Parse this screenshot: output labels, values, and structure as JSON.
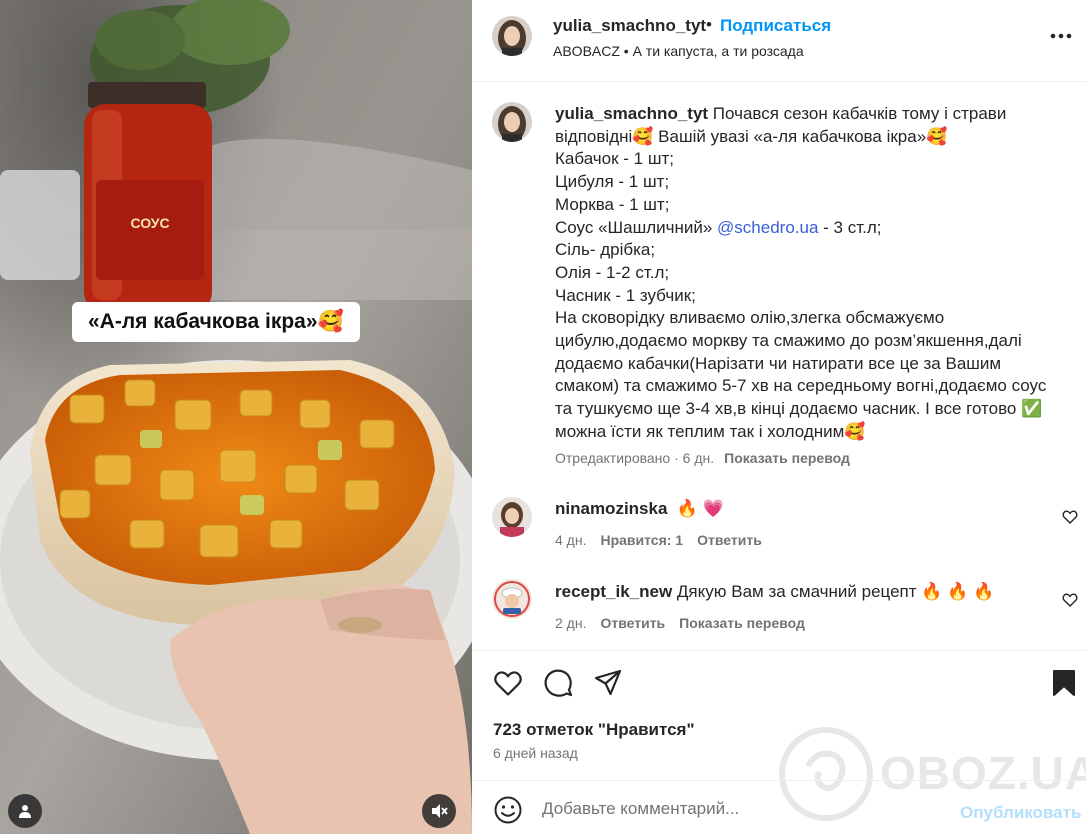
{
  "media": {
    "overlay_caption": "«А-ля кабачкова ікра»🥰"
  },
  "header": {
    "username": "yulia_smachno_tyt",
    "dot": "•",
    "follow_label": "Подписаться",
    "audio": "ABOBACZ • А ти капуста, а ти розсада"
  },
  "caption": {
    "username": "yulia_smachno_tyt",
    "lines": [
      "Почався сезон кабачків тому і страви",
      "відповідні🥰  Вашій увазі «а-ля кабачкова ікра»🥰",
      "Кабачок - 1 шт;",
      "Цибуля - 1 шт;",
      "Морква - 1 шт;",
      "Соус «Шашличний» ",
      "Сіль- дрібка;",
      "Олія - 1-2 ст.л;",
      "Часник - 1 зубчик;",
      "На сковорідку вливаємо олію,злегка обсмажуємо",
      "цибулю,додаємо моркву та смажимо до розм’якшення,далі",
      "додаємо кабачки(Нарізати чи натирати все це за Вашим",
      "смаком) та смажимо 5-7 хв на середньому вогні,додаємо соус",
      "та тушкуємо ще 3-4 хв,в кінці додаємо часник. І все готово ✅",
      "можна їсти як теплим так і холодним🥰"
    ],
    "mention": "@schedro.ua",
    "mention_suffix": " - 3 ст.л;",
    "edited": "Отредактировано",
    "time": " · 6 дн.",
    "translate": "Показать перевод"
  },
  "comments": [
    {
      "username": "ninamozinska",
      "text": "🔥 💗",
      "time": "4 дн.",
      "likes": "Нравится: 1",
      "reply": "Ответить"
    },
    {
      "username": "recept_ik_new",
      "text": "Дякую Вам за смачний рецепт  🔥 🔥 🔥",
      "time": "2 дн.",
      "reply": "Ответить",
      "translate": "Показать перевод"
    }
  ],
  "actions": {
    "likes": "723 отметок \"Нравится\"",
    "posted": "6 дней назад"
  },
  "add_comment": {
    "placeholder": "Добавьте комментарий...",
    "publish": "Опубликовать"
  },
  "watermark": {
    "text": "OBOZ.UA"
  },
  "icons": {
    "like": "heart-icon",
    "comment": "comment-icon",
    "share": "paper-plane-icon",
    "save": "bookmark-icon",
    "more": "more-icon",
    "emoji": "emoji-icon",
    "user_tag": "user-icon",
    "mute": "muted-speaker-icon"
  },
  "colors": {
    "link": "#0095f6",
    "mention": "#3b5fd6",
    "secondary_text": "#737373",
    "publish_disabled": "#b2dffc"
  }
}
